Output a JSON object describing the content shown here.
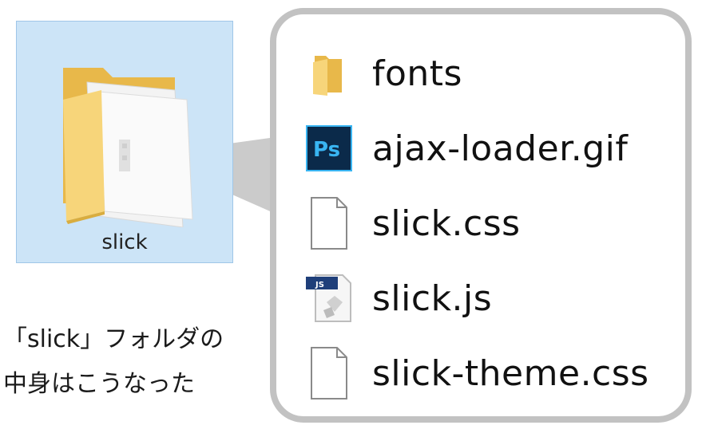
{
  "folder": {
    "name": "slick",
    "icon": "open-folder-icon"
  },
  "contents": {
    "items": [
      {
        "name": "fonts",
        "icon": "folder-icon"
      },
      {
        "name": "ajax-loader.gif",
        "icon": "photoshop-file-icon"
      },
      {
        "name": "slick.css",
        "icon": "blank-file-icon"
      },
      {
        "name": "slick.js",
        "icon": "js-file-icon"
      },
      {
        "name": "slick-theme.css",
        "icon": "blank-file-icon"
      }
    ]
  },
  "caption": {
    "line1": "「slick」フォルダの",
    "line2": "中身はこうなった"
  },
  "colors": {
    "selection_bg": "#cce4f7",
    "selection_border": "#9fc6e8",
    "panel_border": "#c2c2c2",
    "folder_yellow": "#f5cf6a",
    "photoshop_blue": "#0b2a4a",
    "photoshop_text": "#39b5f2"
  }
}
